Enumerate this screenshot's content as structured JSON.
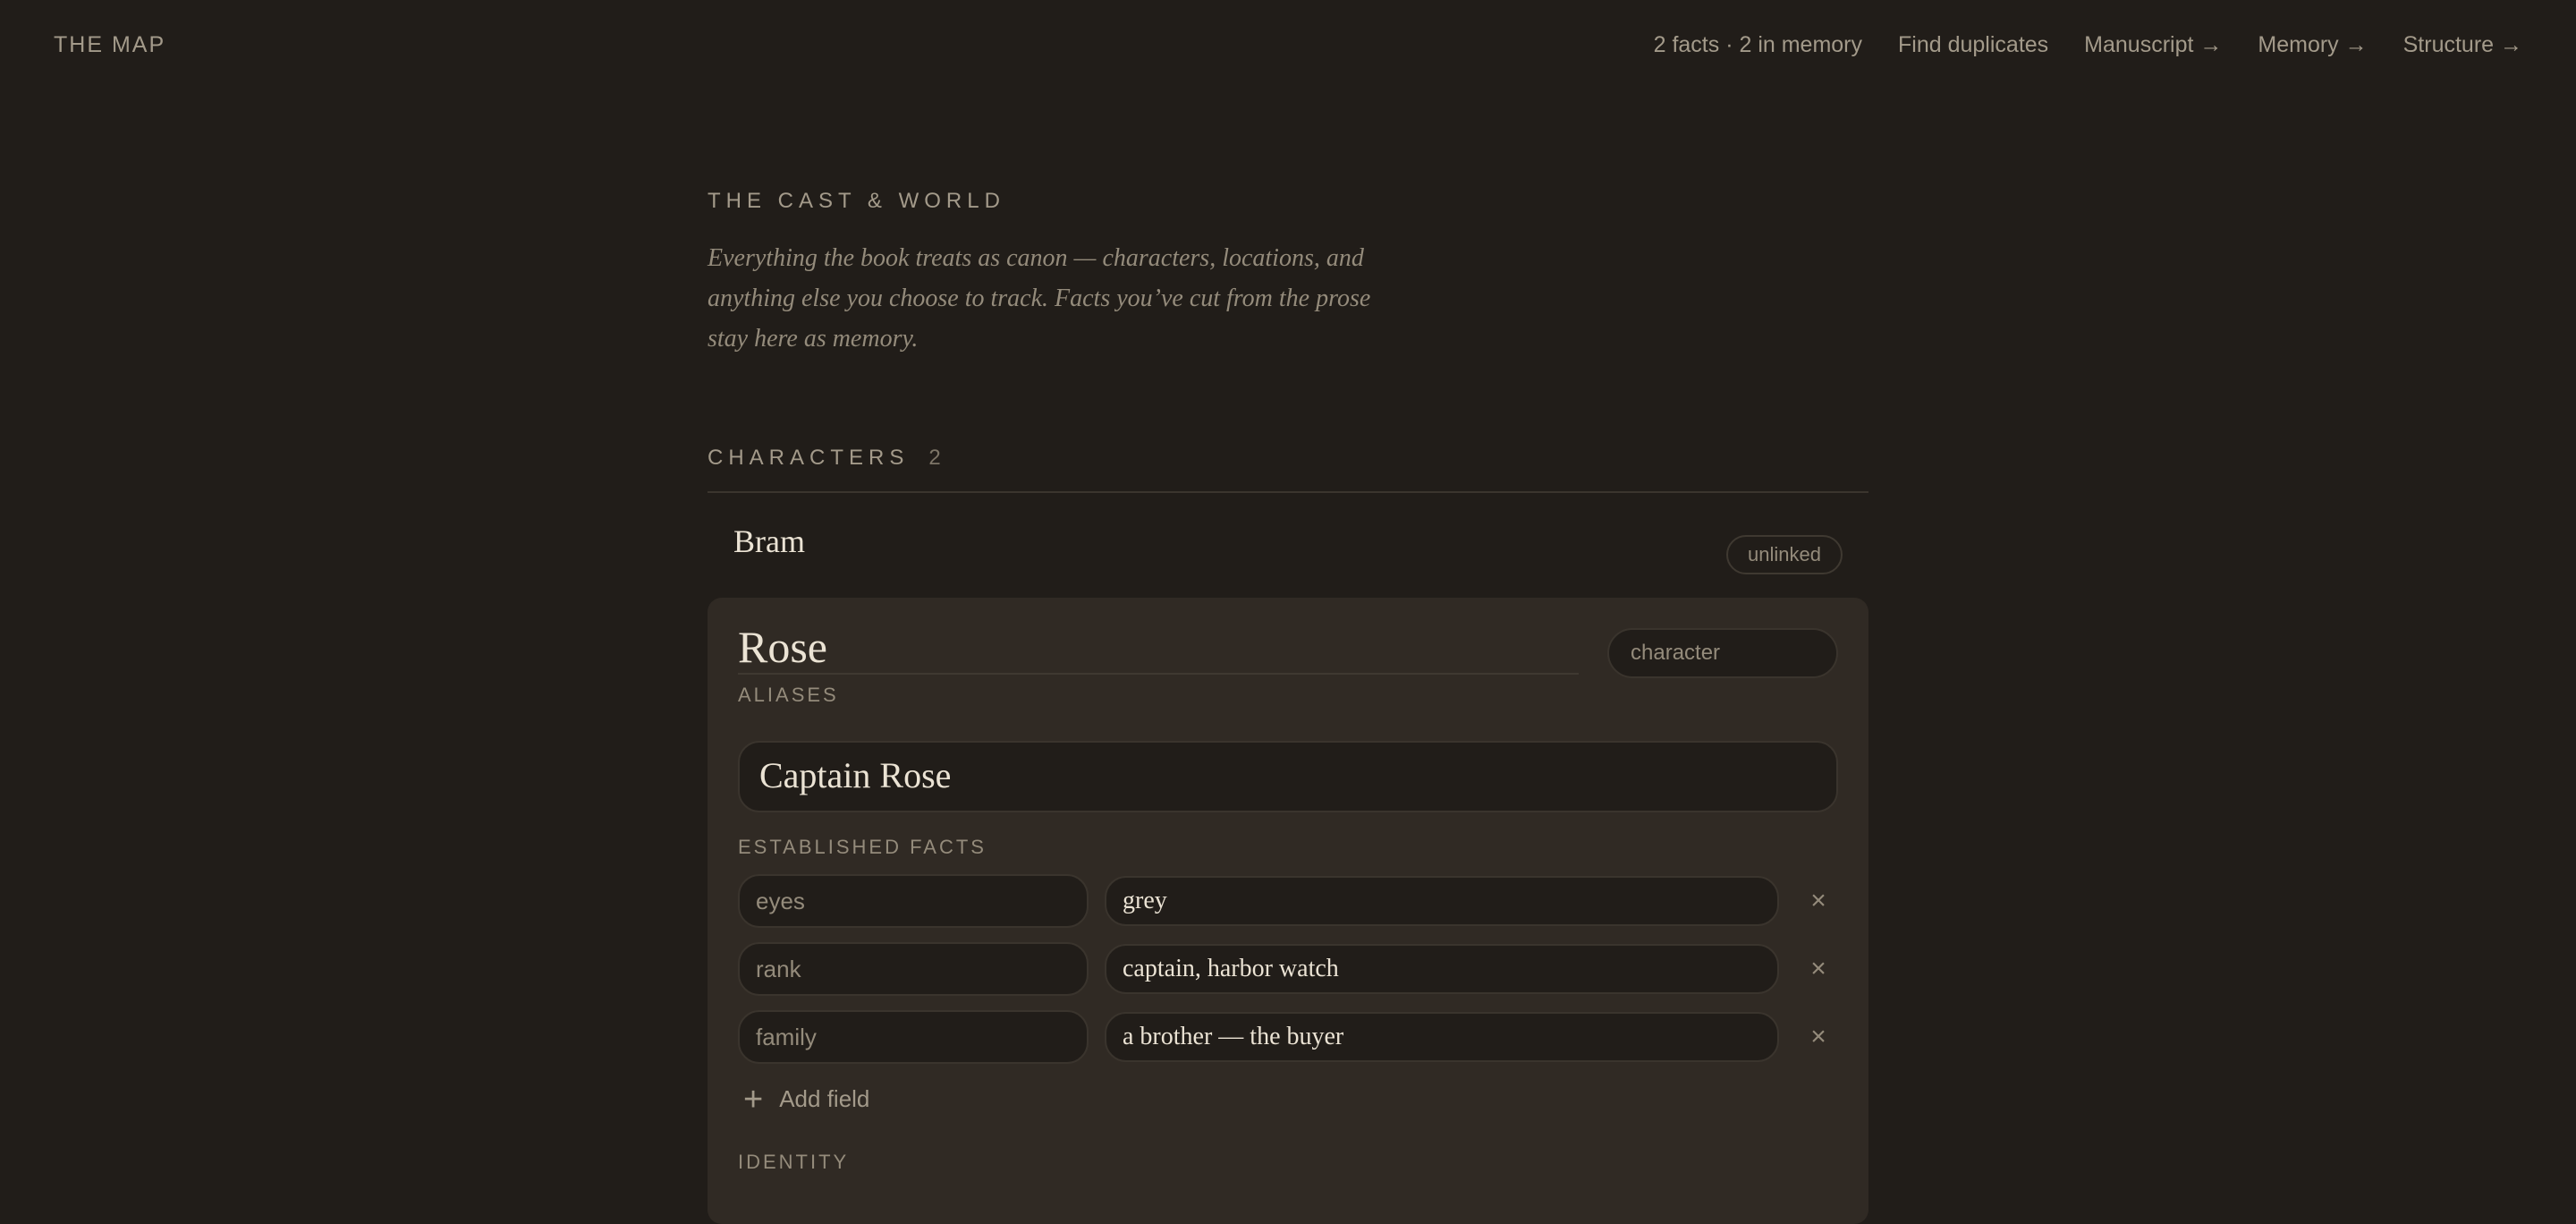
{
  "app": {
    "brand": "THE MAP"
  },
  "nav": {
    "stats": "2 facts · 2 in memory",
    "find_duplicates": "Find duplicates",
    "manuscript": "Manuscript →",
    "memory": "Memory →",
    "structure": "Structure →"
  },
  "page": {
    "eyebrow": "THE CAST & WORLD",
    "intro": "Everything the book treats as canon — characters, locations, and anything else you choose to track. Facts you’ve cut from the prose stay here as memory."
  },
  "characters": {
    "heading": "CHARACTERS",
    "count": "2",
    "items": [
      {
        "name": "Bram",
        "badge": "unlinked"
      }
    ]
  },
  "editor": {
    "name": "Rose",
    "type": "character",
    "aliases_label": "ALIASES",
    "aliases_value": "Captain Rose",
    "facts_label": "ESTABLISHED FACTS",
    "facts": [
      {
        "key": "eyes",
        "value": "grey"
      },
      {
        "key": "rank",
        "value": "captain, harbor watch"
      },
      {
        "key": "family",
        "value": "a brother — the buyer"
      }
    ],
    "remove_glyph": "×",
    "add_field_icon": "+",
    "add_field_label": "Add field",
    "identity_label": "IDENTITY"
  }
}
